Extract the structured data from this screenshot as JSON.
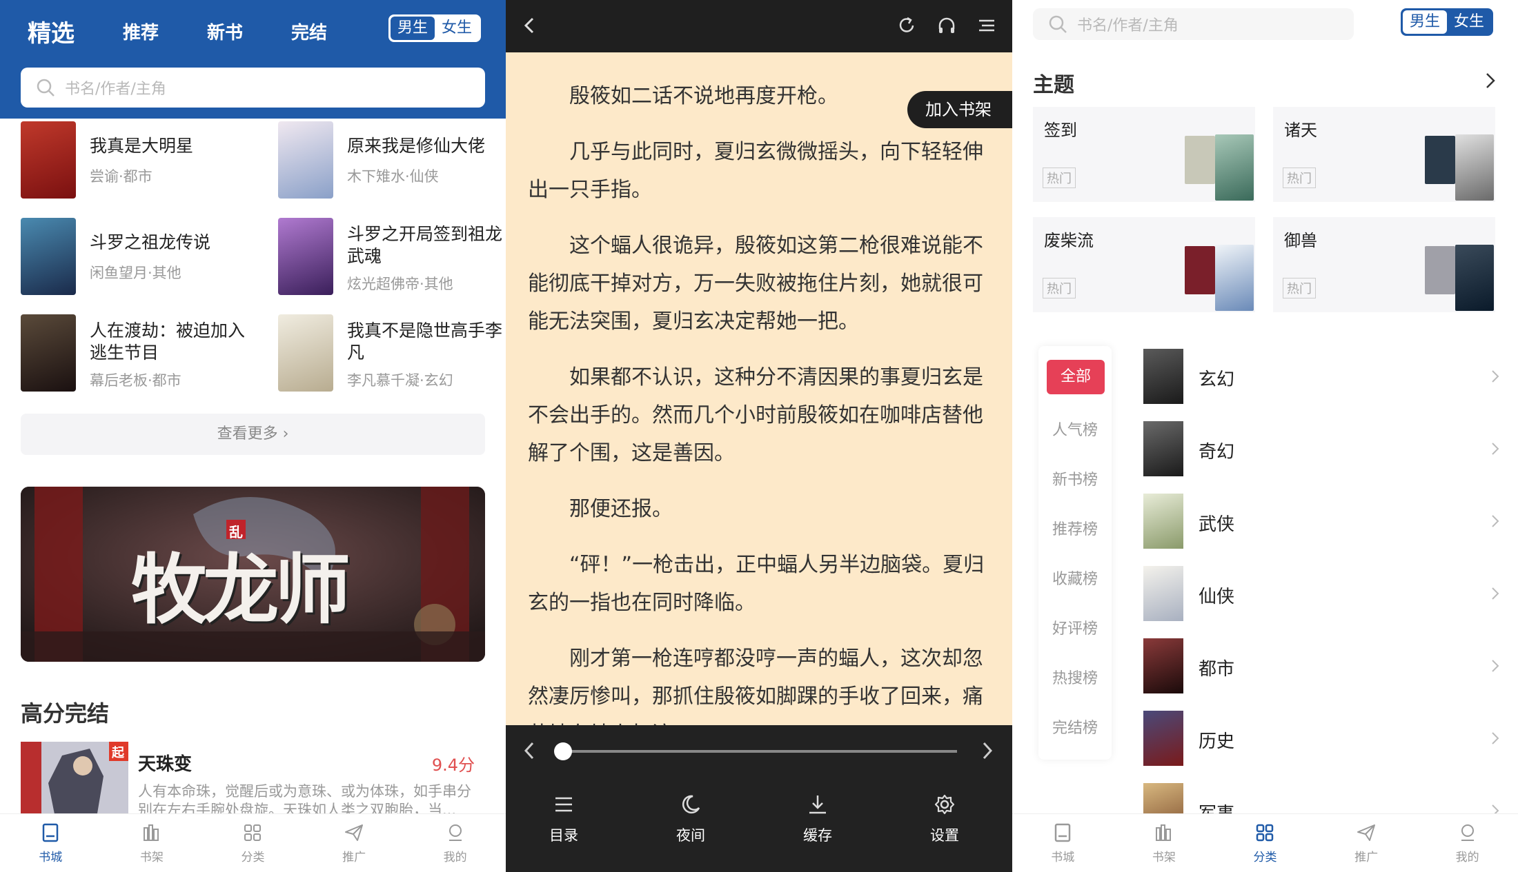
{
  "panel1": {
    "tabs": [
      "精选",
      "推荐",
      "新书",
      "完结"
    ],
    "gender": {
      "male": "男生",
      "female": "女生"
    },
    "search_placeholder": "书名/作者/主角",
    "books": [
      {
        "title": "我真是大明星",
        "meta": "尝谕·都市",
        "cover": "#c0392b"
      },
      {
        "title": "原来我是修仙大佬",
        "meta": "木下雉水·仙侠",
        "cover": "#d9d4e4"
      },
      {
        "title": "斗罗之祖龙传说",
        "meta": "闲鱼望月·其他",
        "cover": "#2c4a6a"
      },
      {
        "title": "斗罗之开局签到祖龙武魂",
        "meta": "炫光超佛帝·其他",
        "cover": "#6b3f8f"
      },
      {
        "title": "人在渡劫：被迫加入逃生节目",
        "meta": "幕后老板·都市",
        "cover": "#3a2a2a"
      },
      {
        "title": "我真不是隐世高手李凡",
        "meta": "李凡慕千凝·玄幻",
        "cover": "#e8e2d4"
      }
    ],
    "more_label": "查看更多 ›",
    "banner_text": "牧龙师",
    "banner_badge": "乱",
    "section_title": "高分完结",
    "highlight": {
      "title": "天珠变",
      "score": "9.4分",
      "desc": "人有本命珠，觉醒后或为意珠、或为体珠，如手串分别在左右手腕处盘旋。天珠如人类之双胞胎，当...",
      "badge": "起"
    },
    "tabbar": [
      "书城",
      "书架",
      "分类",
      "推广",
      "我的"
    ],
    "active_tab": "书城"
  },
  "panel2": {
    "add_shelf": "加入书架",
    "paragraphs": [
      "殷筱如二话不说地再度开枪。",
      "几乎与此同时，夏归玄微微摇头，向下轻轻伸出一只手指。",
      "这个蝠人很诡异，殷筱如这第二枪很难说能不能彻底干掉对方，万一失败被拖住片刻，她就很可能无法突围，夏归玄决定帮她一把。",
      "如果都不认识，这种分不清因果的事夏归玄是不会出手的。然而几个小时前殷筱如在咖啡店替他解了个围，这是善因。",
      "那便还报。",
      "“砰！”一枪击出，正中蝠人另半边脑袋。夏归玄的一指也在同时降临。",
      "刚才第一枪连哼都没哼一声的蝠人，这次却忽然凄厉惨叫，那抓住殷筱如脚踝的手收了回来，痛苦地在地上打滚。"
    ],
    "progress": 0.0,
    "controls": [
      "目录",
      "夜间",
      "缓存",
      "设置"
    ]
  },
  "panel3": {
    "search_placeholder": "书名/作者/主角",
    "gender": {
      "male": "男生",
      "female": "女生"
    },
    "topic_title": "主题",
    "topics": [
      {
        "name": "签到",
        "tag": "热门",
        "c1": "#b8b8a8",
        "c2": "#4d7a5a"
      },
      {
        "name": "诸天",
        "tag": "热门",
        "c1": "#2a3a4a",
        "c2": "#c8c8c8"
      },
      {
        "name": "废柴流",
        "tag": "热门",
        "c1": "#7a1f2a",
        "c2": "#e0e8f0"
      },
      {
        "name": "御兽",
        "tag": "热门",
        "c1": "#9a9aa0",
        "c2": "#1a2a3a"
      }
    ],
    "ranks": [
      "全部",
      "人气榜",
      "新书榜",
      "推荐榜",
      "收藏榜",
      "好评榜",
      "热搜榜",
      "完结榜"
    ],
    "categories": [
      {
        "name": "玄幻",
        "cover": "#2d2d2d"
      },
      {
        "name": "奇幻",
        "cover": "#3a3a3a"
      },
      {
        "name": "武侠",
        "cover": "#d8dcc8"
      },
      {
        "name": "仙侠",
        "cover": "#e8e6e0"
      },
      {
        "name": "都市",
        "cover": "#5a2a2a"
      },
      {
        "name": "历史",
        "cover": "#3a3a5a"
      },
      {
        "name": "军事",
        "cover": "#c0a070"
      }
    ],
    "tabbar": [
      "书城",
      "书架",
      "分类",
      "推广",
      "我的"
    ],
    "active_tab": "分类"
  },
  "colors": {
    "primary": "#1f5aa8",
    "accent": "#e64057",
    "reader_bg": "#fde9c9",
    "dark": "#1f1f1f"
  }
}
